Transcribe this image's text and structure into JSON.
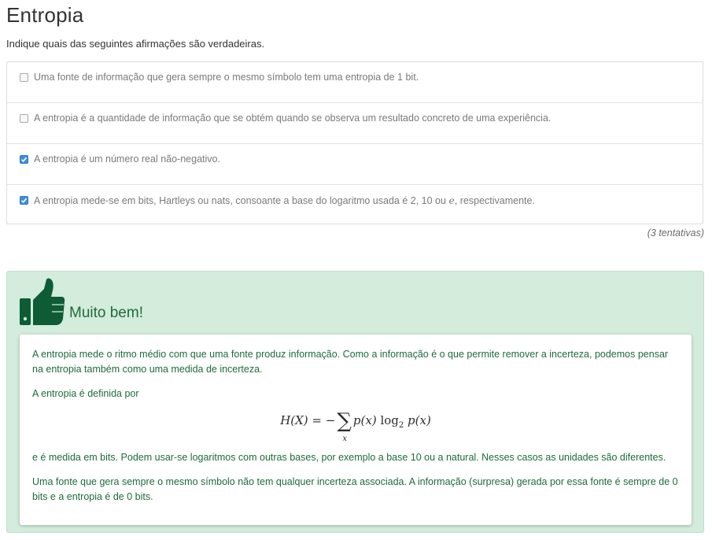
{
  "title": "Entropia",
  "instructions": "Indique quais das seguintes afirmações são verdadeiras.",
  "options": [
    {
      "text": "Uma fonte de informação que gera sempre o mesmo símbolo tem uma entropia de 1 bit.",
      "checked": false
    },
    {
      "text": "A entropia é a quantidade de informação que se obtém quando se observa um resultado concreto de uma experiência.",
      "checked": false
    },
    {
      "text": "A entropia é um número real não-negativo.",
      "checked": true
    },
    {
      "text_before": "A entropia mede-se em bits, Hartleys ou nats, consoante a base do logaritmo usada é 2, 10 ou ",
      "text_math": "e",
      "text_after": ", respectivamente.",
      "checked": true
    }
  ],
  "attempts": "(3 tentativas)",
  "feedback": {
    "verdict": "Muito bem!",
    "icon": "thumbs-up-icon",
    "paragraph1": "A entropia mede o ritmo médio com que uma fonte produz informação. Como a informação é o que permite remover a incerteza, podemos pensar na entropia também como uma medida de incerteza.",
    "paragraph2": "A entropia é definida por",
    "formula": {
      "lhs": "H(X)",
      "eq": " = −",
      "sum": "∑",
      "sum_index": "x",
      "term1": "p(x)",
      "log": " log",
      "log_base": "2",
      "term2": "p(x)"
    },
    "paragraph3": "e é medida em bits. Podem usar-se logaritmos com outras bases, por exemplo a base 10 ou a natural. Nesses casos as unidades são diferentes.",
    "paragraph4": "Uma fonte que gera sempre o mesmo símbolo não tem qualquer incerteza associada. A informação (surpresa) gerada por essa fonte é sempre de 0 bits e a entropia é de 0 bits."
  },
  "colors": {
    "success_bg": "#d3ecdc",
    "success_text": "#1e6b3c",
    "checkbox_checked": "#3b8ede"
  }
}
